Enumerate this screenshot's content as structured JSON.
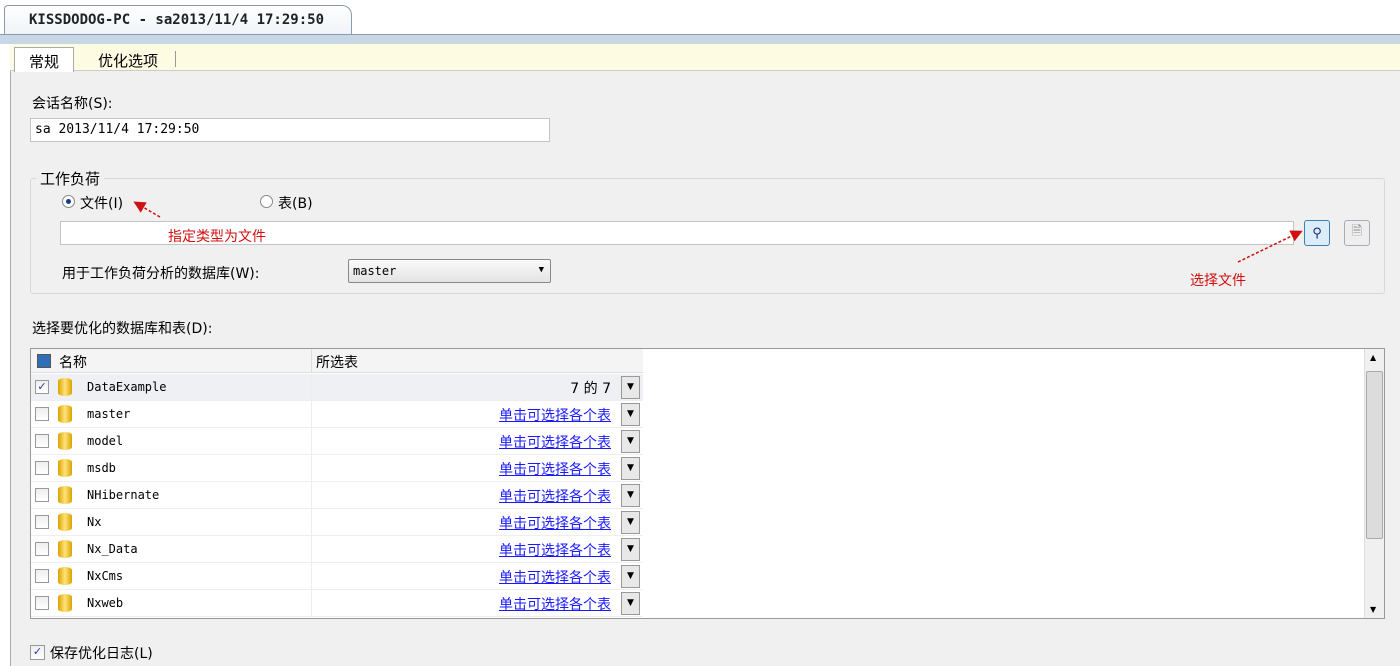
{
  "document_tab": "KISSDODOG-PC - sa2013/11/4 17:29:50",
  "tabs": [
    "常规",
    "优化选项"
  ],
  "session_name": {
    "label": "会话名称(S):",
    "value": "sa 2013/11/4 17:29:50"
  },
  "workload": {
    "title": "工作负荷",
    "file_radio": "文件(I)",
    "table_radio": "表(B)",
    "file_path": "",
    "db_label": "用于工作负荷分析的数据库(W):",
    "db_value": "master"
  },
  "annotations": {
    "type_note": "指定类型为文件",
    "choose_file": "选择文件"
  },
  "db_section_label": "选择要优化的数据库和表(D):",
  "grid": {
    "headers": [
      "名称",
      "所选表"
    ],
    "rows": [
      {
        "name": "DataExample",
        "checked": true,
        "tables": "7 的 7",
        "link": false
      },
      {
        "name": "master",
        "checked": false,
        "tables": "单击可选择各个表",
        "link": true
      },
      {
        "name": "model",
        "checked": false,
        "tables": "单击可选择各个表",
        "link": true
      },
      {
        "name": "msdb",
        "checked": false,
        "tables": "单击可选择各个表",
        "link": true
      },
      {
        "name": "NHibernate",
        "checked": false,
        "tables": "单击可选择各个表",
        "link": true
      },
      {
        "name": "Nx",
        "checked": false,
        "tables": "单击可选择各个表",
        "link": true
      },
      {
        "name": "Nx_Data",
        "checked": false,
        "tables": "单击可选择各个表",
        "link": true
      },
      {
        "name": "NxCms",
        "checked": false,
        "tables": "单击可选择各个表",
        "link": true
      },
      {
        "name": "Nxweb",
        "checked": false,
        "tables": "单击可选择各个表",
        "link": true
      }
    ]
  },
  "save_log": {
    "label": "保存优化日志(L)",
    "checked": true
  },
  "colors": {
    "annotation": "#d01010",
    "link": "#1a1aff"
  }
}
